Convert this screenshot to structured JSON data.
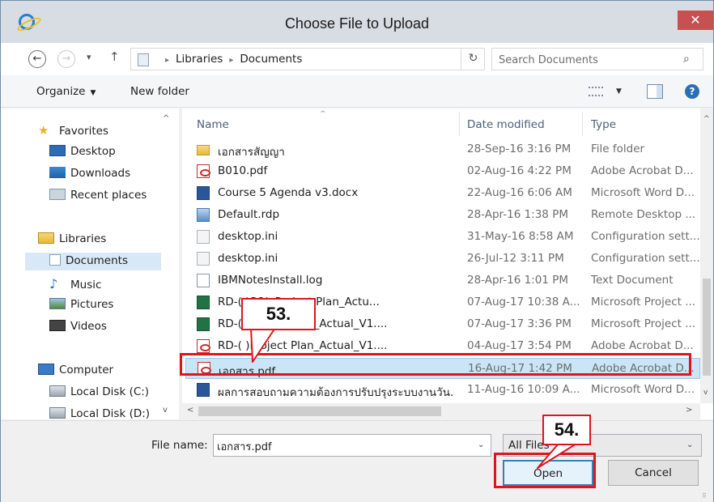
{
  "window": {
    "title": "Choose File to Upload",
    "close_glyph": "✕",
    "app_icon": "internet-explorer-icon"
  },
  "address_bar": {
    "back_glyph": "←",
    "forward_glyph": "→",
    "history_glyph": "▾",
    "up_glyph": "↑",
    "breadcrumb": [
      "Libraries",
      "Documents"
    ],
    "crumb_separator": "▸",
    "dropdown_glyph": "⌄",
    "refresh_glyph": "↻",
    "search_placeholder": "Search Documents",
    "search_glyph": "⌕"
  },
  "toolbar": {
    "organize_label": "Organize",
    "new_folder_label": "New folder",
    "caret_glyph": "▼",
    "help_glyph": "?"
  },
  "navigation": {
    "favorites_header": "Favorites",
    "favorites": [
      "Desktop",
      "Downloads",
      "Recent places"
    ],
    "libraries_header": "Libraries",
    "libraries": [
      "Documents",
      "Music",
      "Pictures",
      "Videos"
    ],
    "computer_header": "Computer",
    "drives": [
      "Local Disk (C:)",
      "Local Disk (D:)"
    ],
    "selected": "Documents",
    "scroll_up_glyph": "^",
    "scroll_down_glyph": "v"
  },
  "file_list": {
    "columns": [
      "Name",
      "Date modified",
      "Type"
    ],
    "sort_glyph": "^",
    "rows": [
      {
        "name": "เอกสารสัญญา",
        "date": "28-Sep-16 3:16 PM",
        "type": "File folder",
        "icon": "folder-icon"
      },
      {
        "name": "B010.pdf",
        "date": "02-Aug-16 4:22 PM",
        "type": "Adobe Acrobat D...",
        "icon": "pdf-icon"
      },
      {
        "name": "Course 5 Agenda v3.docx",
        "date": "22-Aug-16 6:06 AM",
        "type": "Microsoft Word D...",
        "icon": "word-icon"
      },
      {
        "name": "Default.rdp",
        "date": "28-Apr-16 1:38 PM",
        "type": "Remote Desktop ...",
        "icon": "rdp-icon"
      },
      {
        "name": "desktop.ini",
        "date": "31-May-16 8:58 AM",
        "type": "Configuration sett...",
        "icon": "ini-icon"
      },
      {
        "name": "desktop.ini",
        "date": "26-Jul-12 3:11 PM",
        "type": "Configuration sett...",
        "icon": "ini-icon"
      },
      {
        "name": "IBMNotesInstall.log",
        "date": "28-Apr-16 1:01 PM",
        "type": "Text Document",
        "icon": "text-icon"
      },
      {
        "name": "RD-(  )SO)_Project Plan_Actu...",
        "date": "07-Aug-17 10:38 A...",
        "type": "Microsoft Project ...",
        "icon": "project-icon"
      },
      {
        "name": "RD-(  )Project Plan_Actual_V1....",
        "date": "07-Aug-17 3:36 PM",
        "type": "Microsoft Project ...",
        "icon": "project-icon"
      },
      {
        "name": "RD-(  )Project Plan_Actual_V1....",
        "date": "04-Aug-17 3:54 PM",
        "type": "Adobe Acrobat D...",
        "icon": "pdf-icon"
      },
      {
        "name": "เอกสาร.pdf",
        "date": "16-Aug-17 1:42 PM",
        "type": "Adobe Acrobat D...",
        "icon": "pdf-icon",
        "selected": true
      },
      {
        "name": "ผลการสอบถามความต้องการปรับปรุงระบบงานวัน...",
        "date": "11-Aug-16 10:09 A...",
        "type": "Microsoft Word D...",
        "icon": "word-icon"
      }
    ]
  },
  "scrollbars": {
    "up_glyph": "^",
    "down_glyph": "v",
    "left_glyph": "<",
    "right_glyph": ">"
  },
  "footer": {
    "file_name_label": "File name:",
    "file_name_value": "เอกสาร.pdf",
    "file_type_value": "All Files",
    "dropdown_glyph": "⌄",
    "open_label": "Open",
    "cancel_label": "Cancel",
    "grip_glyph": "⠿"
  },
  "annotations": {
    "step_53": "53.",
    "step_54": "54.",
    "color": "#e0141c"
  }
}
